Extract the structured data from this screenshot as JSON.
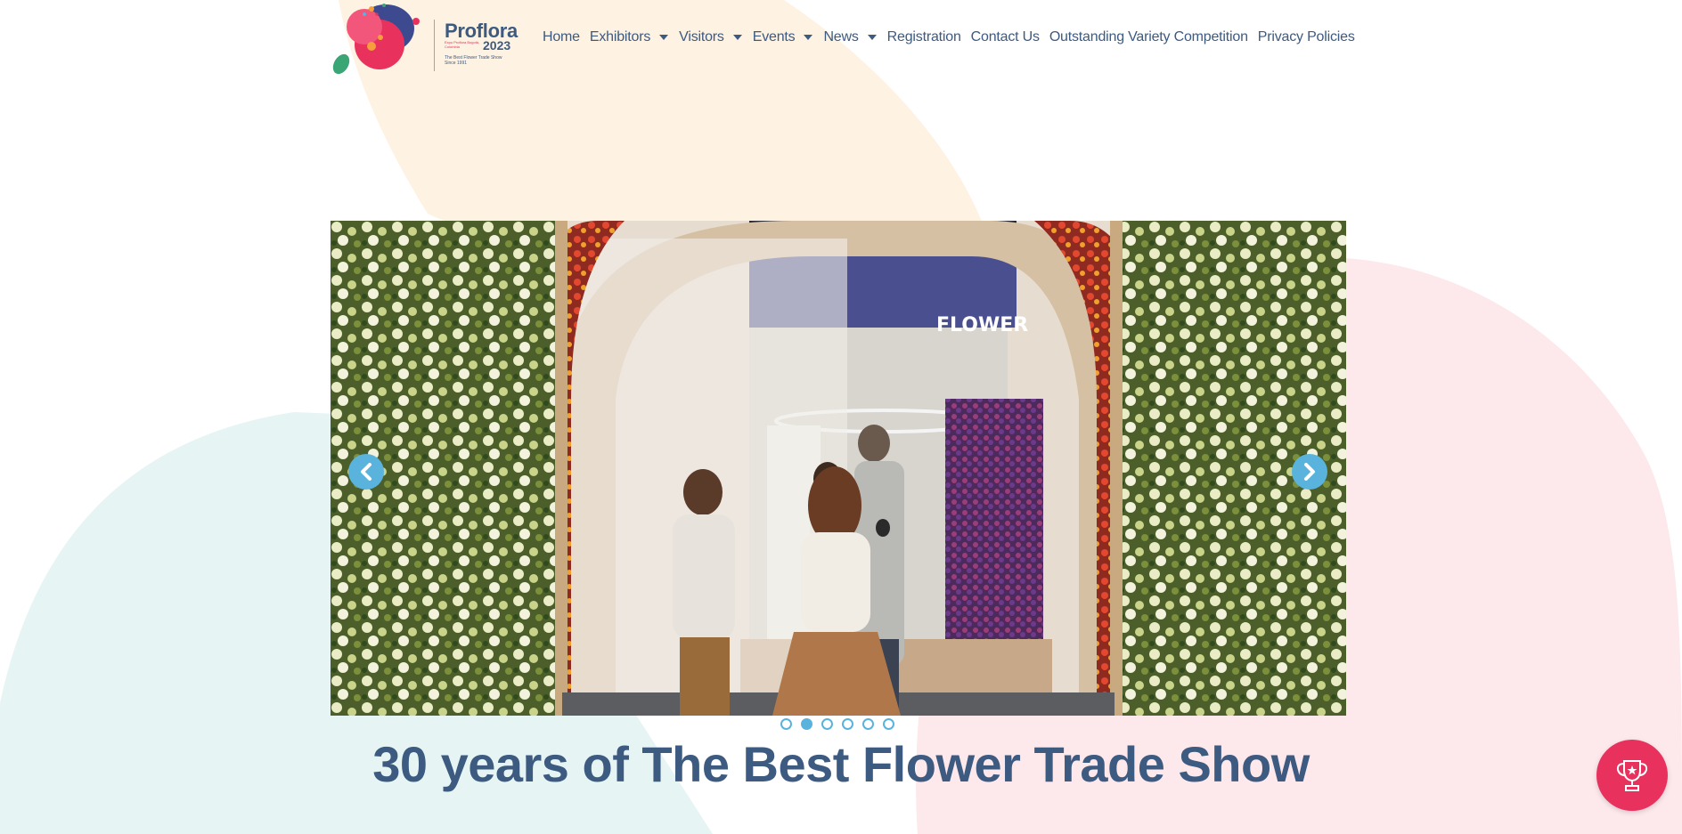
{
  "brand": {
    "name": "Proflora",
    "year": "2023",
    "tiny_line": "Expo Proflora Bogotá, Colombia",
    "tagline_1": "The Best Flower Trade Show",
    "tagline_2": "Since 1991"
  },
  "nav": {
    "items": [
      {
        "label": "Home",
        "dropdown": false
      },
      {
        "label": "Exhibitors",
        "dropdown": true
      },
      {
        "label": "Visitors",
        "dropdown": true
      },
      {
        "label": "Events",
        "dropdown": true
      },
      {
        "label": "News",
        "dropdown": true
      },
      {
        "label": "Registration",
        "dropdown": false
      },
      {
        "label": "Contact Us",
        "dropdown": false
      },
      {
        "label": "Outstanding Variety Competition",
        "dropdown": false
      },
      {
        "label": "Privacy Policies",
        "dropdown": false
      }
    ]
  },
  "slider": {
    "slide_count": 6,
    "active_index": 1,
    "prev_icon": "chevron-left-icon",
    "next_icon": "chevron-right-icon",
    "scene_sign": "FLOWER"
  },
  "hero": {
    "headline": "30 years of The Best Flower Trade Show"
  },
  "fab": {
    "icon": "trophy-icon"
  },
  "colors": {
    "primary_text": "#3d5a80",
    "accent_blue": "#5ab3dc",
    "accent_pink": "#e8325d",
    "bg_peach": "#fef2e3",
    "bg_pink": "#fde8ec",
    "bg_mint": "#e6f5f4"
  }
}
